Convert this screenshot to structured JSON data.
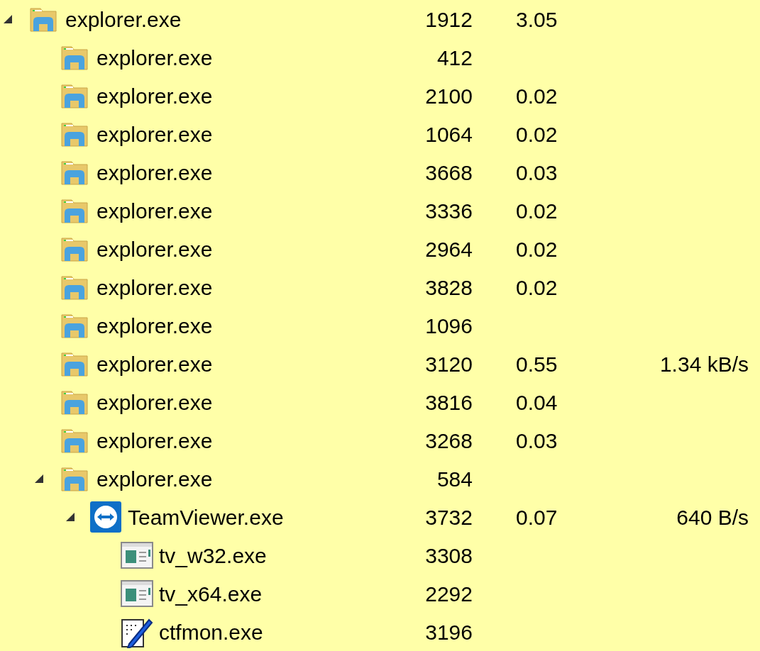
{
  "processes": [
    {
      "name": "explorer.exe",
      "kind": "folder",
      "pid": "1912",
      "cpu": "3.05",
      "expanded": true,
      "children": [
        {
          "name": "explorer.exe",
          "kind": "folder",
          "pid": "412"
        },
        {
          "name": "explorer.exe",
          "kind": "folder",
          "pid": "2100",
          "cpu": "0.02"
        },
        {
          "name": "explorer.exe",
          "kind": "folder",
          "pid": "1064",
          "cpu": "0.02"
        },
        {
          "name": "explorer.exe",
          "kind": "folder",
          "pid": "3668",
          "cpu": "0.03"
        },
        {
          "name": "explorer.exe",
          "kind": "folder",
          "pid": "3336",
          "cpu": "0.02"
        },
        {
          "name": "explorer.exe",
          "kind": "folder",
          "pid": "2964",
          "cpu": "0.02"
        },
        {
          "name": "explorer.exe",
          "kind": "folder",
          "pid": "3828",
          "cpu": "0.02"
        },
        {
          "name": "explorer.exe",
          "kind": "folder",
          "pid": "1096"
        },
        {
          "name": "explorer.exe",
          "kind": "folder",
          "pid": "3120",
          "cpu": "0.55",
          "network": "1.34 kB/s"
        },
        {
          "name": "explorer.exe",
          "kind": "folder",
          "pid": "3816",
          "cpu": "0.04"
        },
        {
          "name": "explorer.exe",
          "kind": "folder",
          "pid": "3268",
          "cpu": "0.03"
        },
        {
          "name": "explorer.exe",
          "kind": "folder",
          "pid": "584",
          "expanded": true,
          "children": [
            {
              "name": "TeamViewer.exe",
              "kind": "teamviewer",
              "pid": "3732",
              "cpu": "0.07",
              "network": "640 B/s",
              "expanded": true,
              "children": [
                {
                  "name": "tv_w32.exe",
                  "kind": "window",
                  "pid": "3308"
                },
                {
                  "name": "tv_x64.exe",
                  "kind": "window",
                  "pid": "2292"
                },
                {
                  "name": "ctfmon.exe",
                  "kind": "notepad",
                  "pid": "3196"
                }
              ]
            }
          ]
        }
      ]
    }
  ]
}
